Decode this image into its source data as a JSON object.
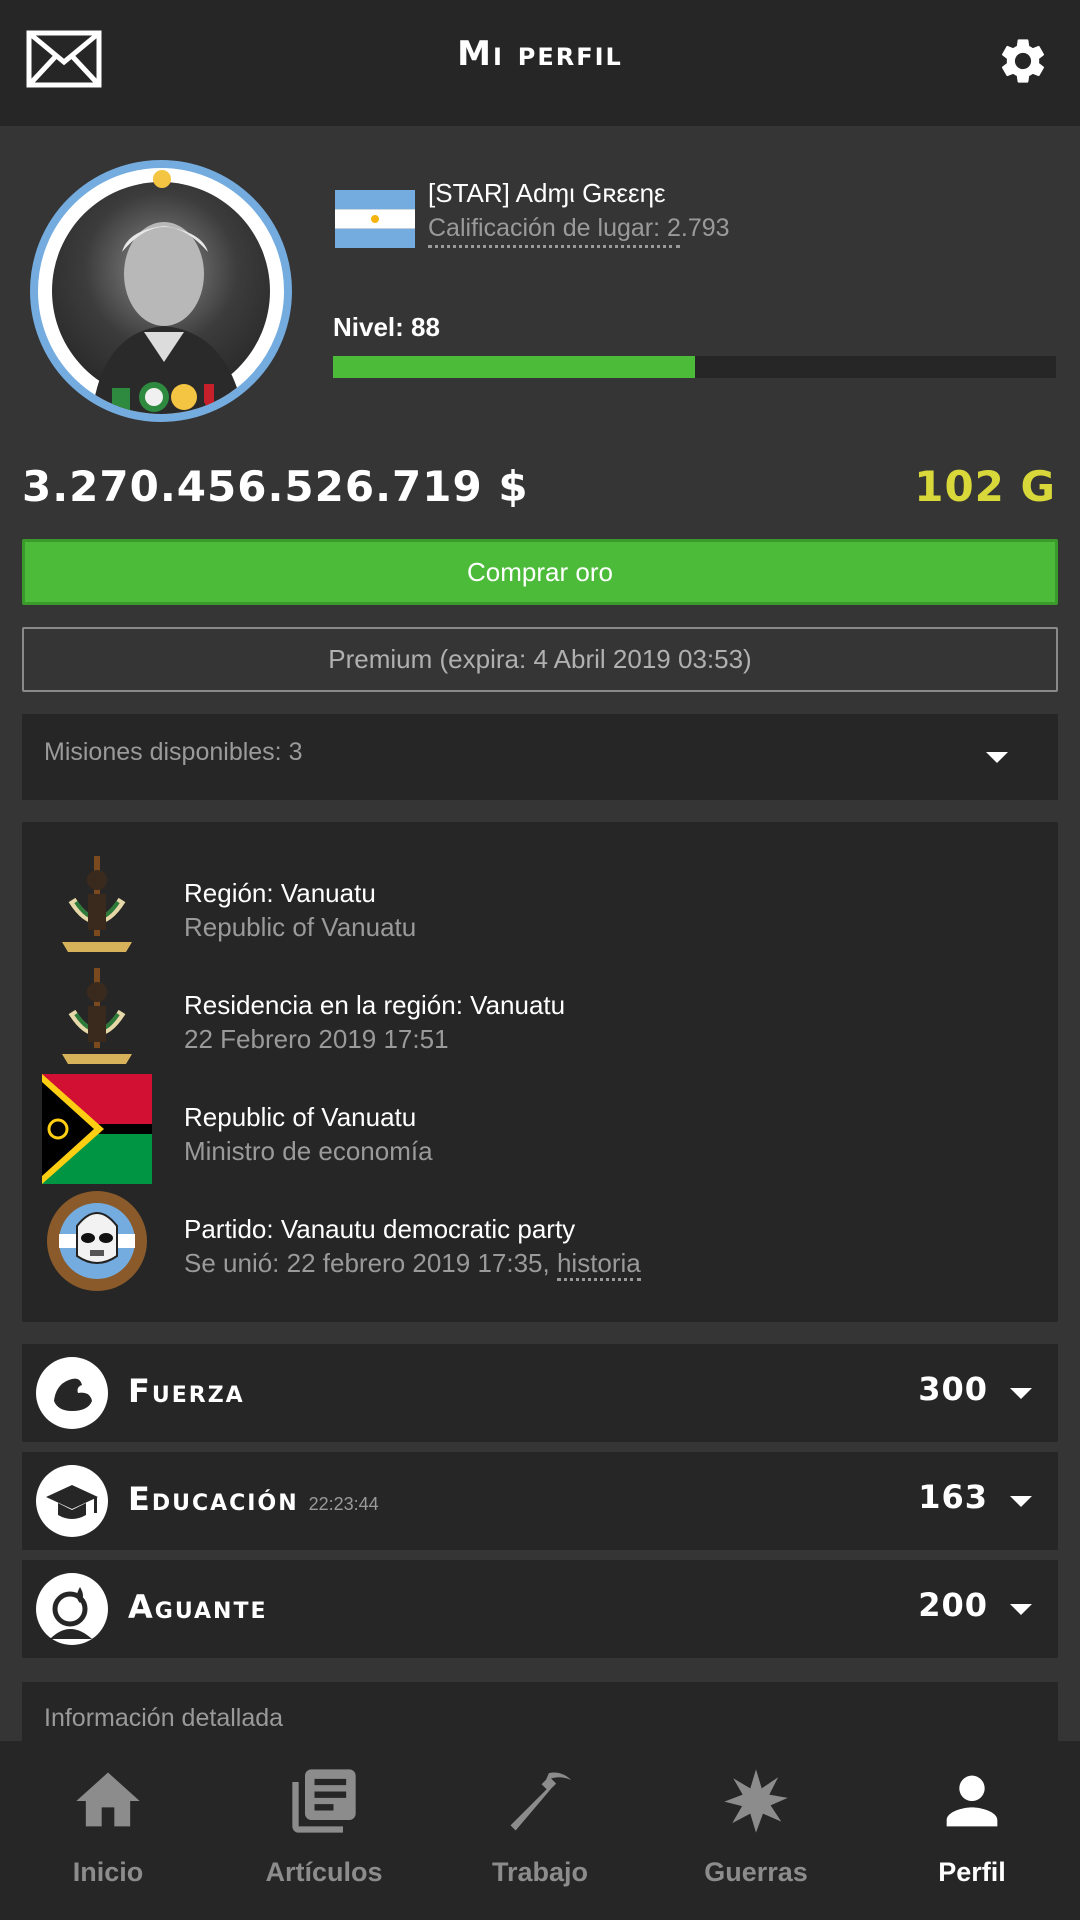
{
  "header": {
    "title": "Mi perfil",
    "mail_icon": "mail-icon",
    "settings_icon": "gear-icon"
  },
  "profile": {
    "name": "[STAR] Adɱι Gʀεεηε",
    "rating": "Calificación de lugar: 2.793",
    "level_label": "Nivel: 88",
    "level_progress": 0.5,
    "country_flag": "argentina-flag-icon"
  },
  "wallet": {
    "money": "3.270.456.526.719 $",
    "gold": "102 G"
  },
  "buttons": {
    "buy_gold": "Comprar oro",
    "premium": "Premium (expira: 4 Abril 2019 03:53)"
  },
  "missions": {
    "label": "Misiones disponibles: 3"
  },
  "info": {
    "region": {
      "title": "Región: Vanuatu",
      "subtitle": "Republic of Vanuatu"
    },
    "residence": {
      "title": "Residencia en la región: Vanuatu",
      "subtitle": "22 Febrero 2019 17:51"
    },
    "state": {
      "title": "Republic of Vanuatu",
      "subtitle": "Ministro de economía"
    },
    "party": {
      "title": "Partido: Vanautu democratic party",
      "subtitle": "Se unió: 22 febrero 2019 17:35, ",
      "link": "historia"
    }
  },
  "stats": [
    {
      "name": "Fuerza",
      "timer": "",
      "value": "300",
      "icon": "muscle-icon"
    },
    {
      "name": "Educación",
      "timer": "22:23:44",
      "value": "163",
      "icon": "graduation-cap-icon"
    },
    {
      "name": "Aguante",
      "timer": "",
      "value": "200",
      "icon": "stamina-icon"
    }
  ],
  "details": {
    "label": "Información detallada"
  },
  "nav": [
    {
      "label": "Inicio",
      "icon": "home-icon"
    },
    {
      "label": "Artículos",
      "icon": "articles-icon"
    },
    {
      "label": "Trabajo",
      "icon": "pickaxe-icon"
    },
    {
      "label": "Guerras",
      "icon": "explosion-icon"
    },
    {
      "label": "Perfil",
      "icon": "person-icon"
    }
  ],
  "colors": {
    "accent_green": "#4cbb3a",
    "gold": "#d8d83a",
    "background": "#353535",
    "panel": "#262626"
  }
}
